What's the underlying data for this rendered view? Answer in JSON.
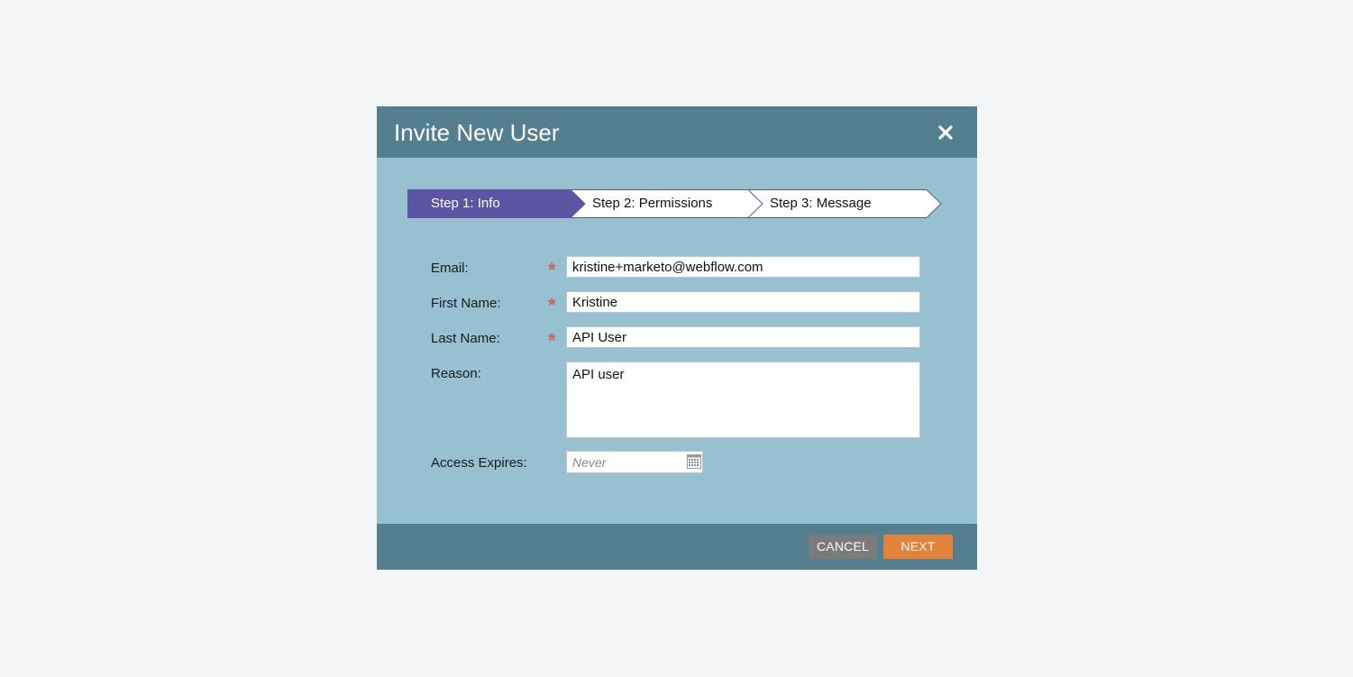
{
  "dialog": {
    "title": "Invite New User",
    "close_icon": "close-icon"
  },
  "steps": [
    {
      "label": "Step 1: Info",
      "active": true
    },
    {
      "label": "Step 2: Permissions",
      "active": false
    },
    {
      "label": "Step 3: Message",
      "active": false
    }
  ],
  "form": {
    "email": {
      "label": "Email:",
      "value": "kristine+marketo@webflow.com",
      "required": true
    },
    "first_name": {
      "label": "First Name:",
      "value": "Kristine",
      "required": true
    },
    "last_name": {
      "label": "Last Name:",
      "value": "API User",
      "required": true
    },
    "reason": {
      "label": "Reason:",
      "value": "API user"
    },
    "access_expires": {
      "label": "Access Expires:",
      "placeholder": "Never",
      "icon": "calendar-icon"
    },
    "required_marker": "*"
  },
  "footer": {
    "cancel_label": "CANCEL",
    "next_label": "NEXT"
  },
  "colors": {
    "page_bg": "#f5f6f8",
    "header_bg": "#547f8f",
    "body_bg": "#97c0d1",
    "step_active": "#5b55a4",
    "required": "#c7655c",
    "cancel_bg": "#7b7b7b",
    "next_bg": "#e3823a"
  }
}
